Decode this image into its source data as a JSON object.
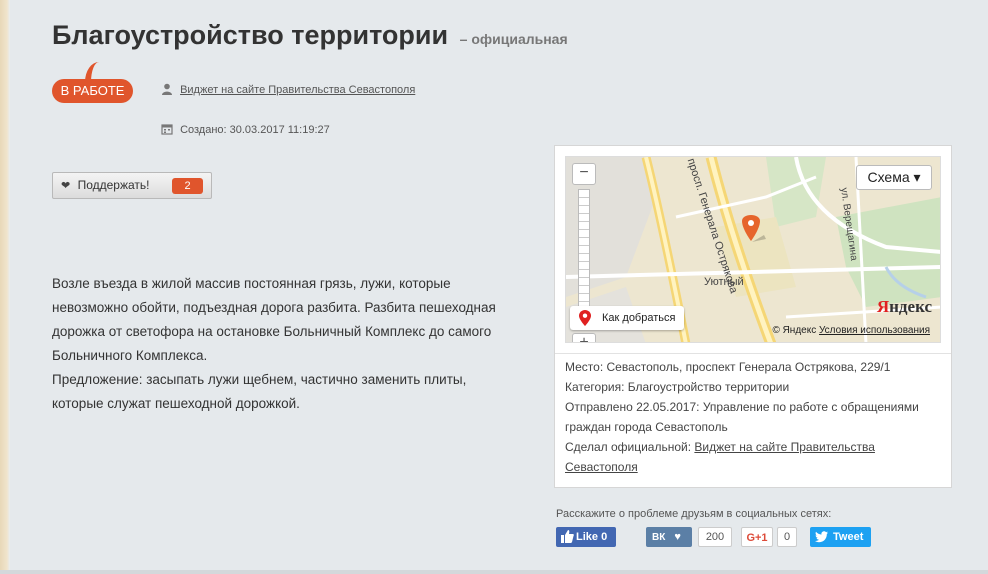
{
  "header": {
    "title": "Благоустройство территории",
    "title_suffix": "– официальная"
  },
  "status": {
    "label": "В РАБОТЕ",
    "color": "#e0552c"
  },
  "meta": {
    "author_link": "Виджет на сайте Правительства Севастополя",
    "created": "Создано: 30.03.2017 11:19:27"
  },
  "support": {
    "label": "Поддержать!",
    "count": "2"
  },
  "description": {
    "lines": [
      "Возле въезда в жилой массив постоянная грязь, лужи, которые",
      "невозможно обойти, подъездная дорога разбита. Разбита пешеходная",
      "дорожка от светофора на остановке Больничный Комплекс до самого",
      "Больничного Комплекса.",
      "Предложение: засыпать лужи щебнем, частично заменить плиты,",
      "которые служат пешеходной дорожкой."
    ]
  },
  "map": {
    "layer_label": "Схема ▾",
    "route_label": "Как добраться",
    "copyright": "© Яндекс",
    "terms_link": "Условия использования",
    "logo_black": "Я",
    "logo_rest": "ндекс",
    "street_main": "просп. Генерала Острякова",
    "street_side": "ул. Верещагина",
    "area_label": "Уютный",
    "zoom_in": "−",
    "zoom_out": "+"
  },
  "info": {
    "place": "Место: Севастополь, проспект Генерала Острякова, 229/1",
    "category": "Категория: Благоустройство территории",
    "sent_line1": "Отправлено 22.05.2017: Управление по работе с обращениями",
    "sent_line2": "граждан города Севастополь",
    "official_prefix": "Сделал официальной:",
    "official_link_line1": "Виджет на сайте Правительства",
    "official_link_line2": "Севастополя"
  },
  "share": {
    "title": "Расскажите о проблеме друзьям в социальных сетях:",
    "fb_label": "Like 0",
    "vk_label": "♥",
    "vk_count": "200",
    "gp_label": "G+1",
    "gp_count": "0",
    "tw_label": "Tweet"
  }
}
